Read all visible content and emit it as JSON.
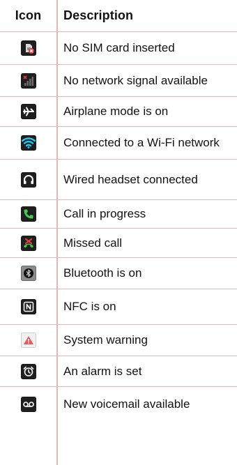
{
  "header": {
    "icon_label": "Icon",
    "description_label": "Description"
  },
  "rows": [
    {
      "icon": "no-sim-icon",
      "description": "No SIM card inserted"
    },
    {
      "icon": "no-signal-icon",
      "description": "No network signal available"
    },
    {
      "icon": "airplane-mode-icon",
      "description": "Airplane mode is on"
    },
    {
      "icon": "wifi-icon",
      "description": "Connected to a Wi-Fi network"
    },
    {
      "icon": "headset-icon",
      "description": "Wired headset connected"
    },
    {
      "icon": "call-in-progress-icon",
      "description": "Call in progress"
    },
    {
      "icon": "missed-call-icon",
      "description": "Missed call"
    },
    {
      "icon": "bluetooth-icon",
      "description": "Bluetooth is on"
    },
    {
      "icon": "nfc-icon",
      "description": "NFC is on"
    },
    {
      "icon": "system-warning-icon",
      "description": "System warning"
    },
    {
      "icon": "alarm-icon",
      "description": "An alarm is set"
    },
    {
      "icon": "voicemail-icon",
      "description": "New voicemail available"
    }
  ],
  "colors": {
    "grid_line": "#e7b6b6",
    "icon_dark": "#222222",
    "wifi_blue": "#22c7f0",
    "call_green": "#3fd04a",
    "missed_red": "#e53d3d",
    "warning_red": "#e25b5b"
  }
}
